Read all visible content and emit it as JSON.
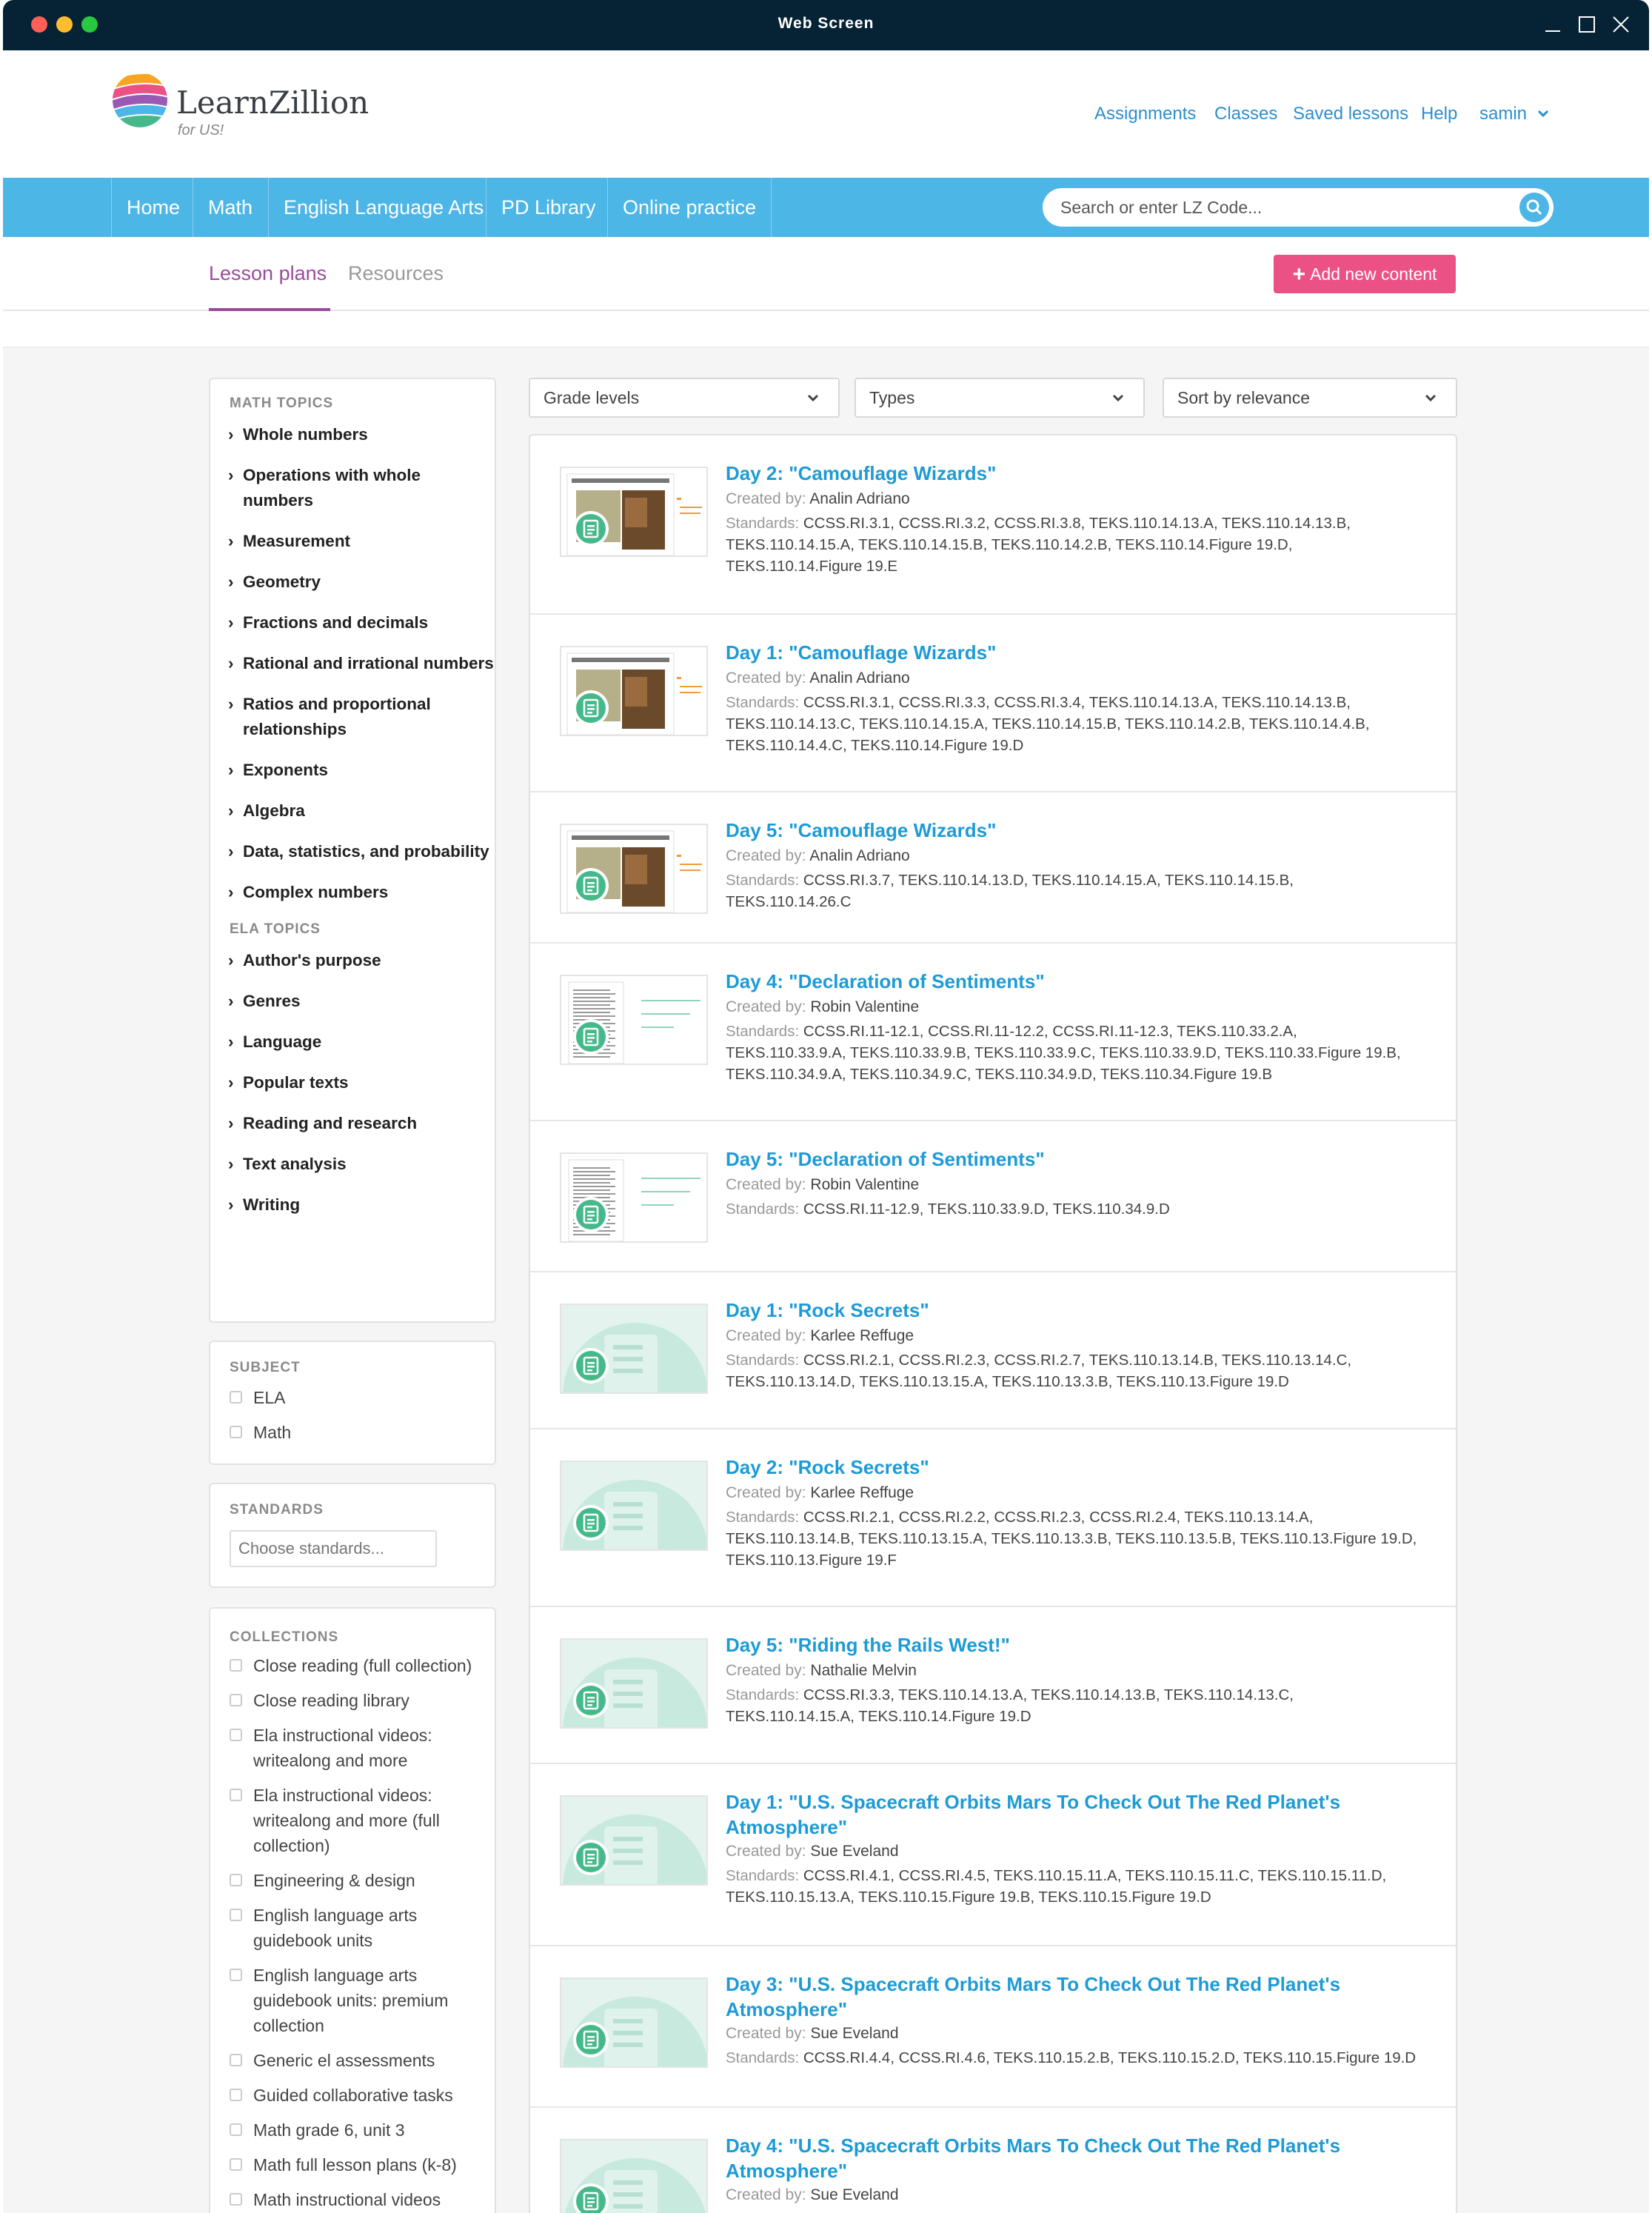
{
  "window": {
    "title": "Web Screen"
  },
  "logo": {
    "name": "LearnZillion",
    "sub": "for US!"
  },
  "topnav": [
    "Assignments",
    "Classes",
    "Saved lessons",
    "Help",
    "samin"
  ],
  "nav": [
    "Home",
    "Math",
    "English Language Arts",
    "PD Library",
    "Online practice"
  ],
  "search": {
    "placeholder": "Search or enter LZ Code..."
  },
  "tabs": {
    "lesson_plans": "Lesson plans",
    "resources": "Resources"
  },
  "add_button": "Add new content",
  "filters": {
    "grade": "Grade levels",
    "types": "Types",
    "sort": "Sort by relevance"
  },
  "math_topics": {
    "heading": "MATH TOPICS",
    "items": [
      "Whole numbers",
      "Operations with whole numbers",
      "Measurement",
      "Geometry",
      "Fractions and decimals",
      "Rational and irrational numbers",
      "Ratios and proportional relationships",
      "Exponents",
      "Algebra",
      "Data, statistics, and probability",
      "Complex numbers"
    ]
  },
  "ela_topics": {
    "heading": "ELA TOPICS",
    "items": [
      "Author's purpose",
      "Genres",
      "Language",
      "Popular texts",
      "Reading and research",
      "Text analysis",
      "Writing"
    ]
  },
  "subject": {
    "heading": "SUBJECT",
    "items": [
      "ELA",
      "Math"
    ]
  },
  "standards": {
    "heading": "STANDARDS",
    "placeholder": "Choose standards..."
  },
  "collections": {
    "heading": "COLLECTIONS",
    "items": [
      "Close reading (full collection)",
      "Close reading library",
      "Ela instructional videos: writealong and more",
      "Ela instructional videos: writealong and more (full collection)",
      "Engineering & design",
      "English language arts guidebook units",
      "English language arts guidebook units: premium collection",
      "Generic el assessments",
      "Guided collaborative tasks",
      "Math grade 6, unit 3",
      "Math full lesson plans (k-8)",
      "Math instructional videos"
    ]
  },
  "labels": {
    "created_by": "Created by:",
    "standards": "Standards:"
  },
  "lessons": [
    {
      "title": "Day 2: \"Camouflage Wizards\"",
      "author": "Analin Adriano",
      "standards": "CCSS.RI.3.1, CCSS.RI.3.2, CCSS.RI.3.8, TEKS.110.14.13.A, TEKS.110.14.13.B, TEKS.110.14.15.A, TEKS.110.14.15.B, TEKS.110.14.2.B, TEKS.110.14.Figure 19.D, TEKS.110.14.Figure 19.E",
      "thumb": "camouflage"
    },
    {
      "title": "Day 1: \"Camouflage Wizards\"",
      "author": "Analin Adriano",
      "standards": "CCSS.RI.3.1, CCSS.RI.3.3, CCSS.RI.3.4, TEKS.110.14.13.A, TEKS.110.14.13.B, TEKS.110.14.13.C, TEKS.110.14.15.A, TEKS.110.14.15.B, TEKS.110.14.2.B, TEKS.110.14.4.B, TEKS.110.14.4.C, TEKS.110.14.Figure 19.D",
      "thumb": "camouflage"
    },
    {
      "title": "Day 5: \"Camouflage Wizards\"",
      "author": "Analin Adriano",
      "standards": "CCSS.RI.3.7, TEKS.110.14.13.D, TEKS.110.14.15.A, TEKS.110.14.15.B, TEKS.110.14.26.C",
      "thumb": "camouflage"
    },
    {
      "title": "Day 4: \"Declaration of Sentiments\"",
      "author": "Robin Valentine",
      "standards": "CCSS.RI.11-12.1, CCSS.RI.11-12.2, CCSS.RI.11-12.3, TEKS.110.33.2.A, TEKS.110.33.9.A, TEKS.110.33.9.B, TEKS.110.33.9.C, TEKS.110.33.9.D, TEKS.110.33.Figure 19.B, TEKS.110.34.9.A, TEKS.110.34.9.C, TEKS.110.34.9.D, TEKS.110.34.Figure 19.B",
      "thumb": "declaration"
    },
    {
      "title": "Day 5: \"Declaration of Sentiments\"",
      "author": "Robin Valentine",
      "standards": "CCSS.RI.11-12.9, TEKS.110.33.9.D, TEKS.110.34.9.D",
      "thumb": "declaration"
    },
    {
      "title": "Day 1: \"Rock Secrets\"",
      "author": "Karlee Reffuge",
      "standards": "CCSS.RI.2.1, CCSS.RI.2.3, CCSS.RI.2.7, TEKS.110.13.14.B, TEKS.110.13.14.C, TEKS.110.13.14.D, TEKS.110.13.15.A, TEKS.110.13.3.B, TEKS.110.13.Figure 19.D",
      "thumb": "generic"
    },
    {
      "title": "Day 2: \"Rock Secrets\"",
      "author": "Karlee Reffuge",
      "standards": "CCSS.RI.2.1, CCSS.RI.2.2, CCSS.RI.2.3, CCSS.RI.2.4, TEKS.110.13.14.A, TEKS.110.13.14.B, TEKS.110.13.15.A, TEKS.110.13.3.B, TEKS.110.13.5.B, TEKS.110.13.Figure 19.D, TEKS.110.13.Figure 19.F",
      "thumb": "generic"
    },
    {
      "title": "Day 5: \"Riding the Rails West!\"",
      "author": "Nathalie Melvin",
      "standards": "CCSS.RI.3.3, TEKS.110.14.13.A, TEKS.110.14.13.B, TEKS.110.14.13.C, TEKS.110.14.15.A, TEKS.110.14.Figure 19.D",
      "thumb": "generic"
    },
    {
      "title": "Day 1: \"U.S. Spacecraft Orbits Mars To Check Out The Red Planet's Atmosphere\"",
      "author": "Sue Eveland",
      "standards": "CCSS.RI.4.1, CCSS.RI.4.5, TEKS.110.15.11.A, TEKS.110.15.11.C, TEKS.110.15.11.D, TEKS.110.15.13.A, TEKS.110.15.Figure 19.B, TEKS.110.15.Figure 19.D",
      "thumb": "generic"
    },
    {
      "title": "Day 3: \"U.S. Spacecraft Orbits Mars To Check Out The Red Planet's Atmosphere\"",
      "author": "Sue Eveland",
      "standards": "CCSS.RI.4.4, CCSS.RI.4.6, TEKS.110.15.2.B, TEKS.110.15.2.D, TEKS.110.15.Figure 19.D",
      "thumb": "generic"
    },
    {
      "title": "Day 4: \"U.S. Spacecraft Orbits Mars To Check Out The Red Planet's Atmosphere\"",
      "author": "Sue Eveland",
      "standards": "",
      "thumb": "generic"
    }
  ],
  "colors": {
    "navbar": "#4cb6e6",
    "accent_link": "#1d9bd6",
    "tab_active": "#9b4a9b",
    "add_button": "#ec5186",
    "titlebar": "#062235",
    "doc_icon": "#46b98b"
  }
}
